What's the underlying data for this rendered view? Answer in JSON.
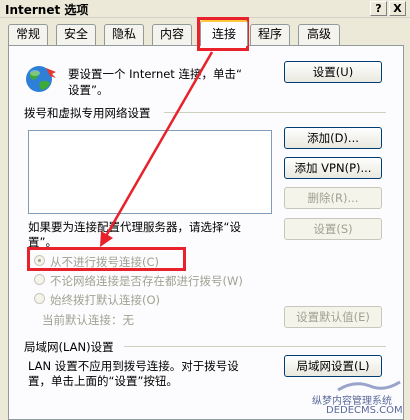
{
  "window": {
    "title": "Internet 选项",
    "help_button": "?",
    "close_button": "X"
  },
  "tabs": [
    {
      "label": "常规"
    },
    {
      "label": "安全"
    },
    {
      "label": "隐私"
    },
    {
      "label": "内容"
    },
    {
      "label": "连接"
    },
    {
      "label": "程序"
    },
    {
      "label": "高级"
    }
  ],
  "active_tab": "连接",
  "setup": {
    "text_line1": "要设置一个 Internet 连接，单击“",
    "text_line2": "设置”。",
    "button": "设置(U)"
  },
  "dialup": {
    "heading": "拨号和虚拟专用网络设置",
    "add_button": "添加(D)...",
    "add_vpn_button": "添加 VPN(P)...",
    "remove_button": "删除(R)...",
    "settings_note_line1": "如果要为连接配置代理服务器，请选择“设",
    "settings_note_line2": "置”。",
    "settings_button": "设置(S)",
    "options": [
      {
        "label": "从不进行拨号连接(C)",
        "selected": true
      },
      {
        "label": "不论网络连接是否存在都进行拨号(W)",
        "selected": false
      },
      {
        "label": "始终拨打默认连接(O)",
        "selected": false
      }
    ],
    "current_default_label": "当前默认连接：",
    "current_default_value": "无",
    "set_default_button": "设置默认值(E)"
  },
  "lan": {
    "heading": "局域网(LAN)设置",
    "text_line1": "LAN 设置不应用到拨号连接。对于拨号设",
    "text_line2": "置，单击上面的“设置”按钮。",
    "button": "局域网设置(L)"
  },
  "watermark": {
    "line1": "纵梦内容管理系统",
    "line2": "DEDECMS.COM"
  },
  "colors": {
    "annotation_red": "#E8212B",
    "tab_highlight": "#FFC83C",
    "dialog_bg": "#ECE9D8"
  }
}
